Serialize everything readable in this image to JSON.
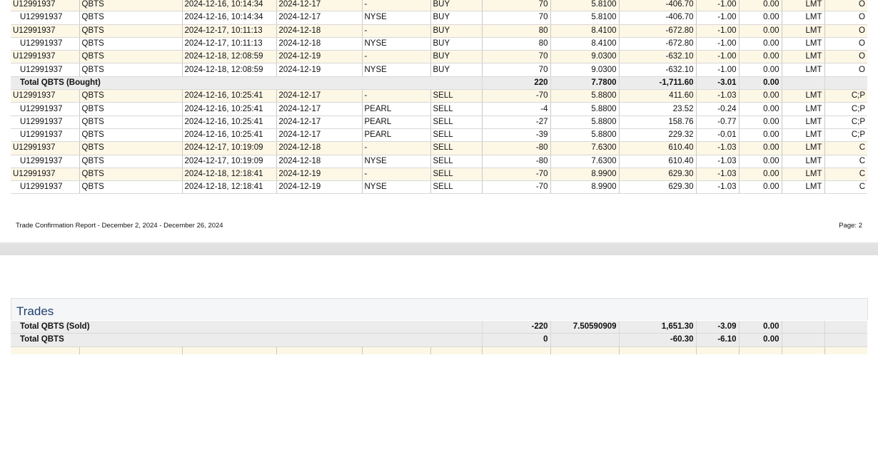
{
  "columns_align": [
    "l",
    "l",
    "l",
    "l",
    "l",
    "l",
    "r",
    "r",
    "r",
    "r",
    "r",
    "r",
    "r"
  ],
  "trades_top": [
    {
      "type": "main",
      "cells": [
        "U12991937",
        "QBTS",
        "2024-12-16, 10:14:34",
        "2024-12-17",
        "-",
        "BUY",
        "70",
        "5.8100",
        "-406.70",
        "-1.00",
        "0.00",
        "LMT",
        "O"
      ]
    },
    {
      "type": "sub",
      "cells": [
        "U12991937",
        "QBTS",
        "2024-12-16, 10:14:34",
        "2024-12-17",
        "NYSE",
        "BUY",
        "70",
        "5.8100",
        "-406.70",
        "-1.00",
        "0.00",
        "LMT",
        "O"
      ]
    },
    {
      "type": "main",
      "cells": [
        "U12991937",
        "QBTS",
        "2024-12-17, 10:11:13",
        "2024-12-18",
        "-",
        "BUY",
        "80",
        "8.4100",
        "-672.80",
        "-1.00",
        "0.00",
        "LMT",
        "O"
      ]
    },
    {
      "type": "sub",
      "cells": [
        "U12991937",
        "QBTS",
        "2024-12-17, 10:11:13",
        "2024-12-18",
        "NYSE",
        "BUY",
        "80",
        "8.4100",
        "-672.80",
        "-1.00",
        "0.00",
        "LMT",
        "O"
      ]
    },
    {
      "type": "main",
      "cells": [
        "U12991937",
        "QBTS",
        "2024-12-18, 12:08:59",
        "2024-12-19",
        "-",
        "BUY",
        "70",
        "9.0300",
        "-632.10",
        "-1.00",
        "0.00",
        "LMT",
        "O"
      ]
    },
    {
      "type": "sub",
      "cells": [
        "U12991937",
        "QBTS",
        "2024-12-18, 12:08:59",
        "2024-12-19",
        "NYSE",
        "BUY",
        "70",
        "9.0300",
        "-632.10",
        "-1.00",
        "0.00",
        "LMT",
        "O"
      ]
    },
    {
      "type": "tot",
      "label": "Total QBTS (Bought)",
      "cells": [
        "220",
        "7.7800",
        "-1,711.60",
        "-3.01",
        "0.00",
        "",
        ""
      ]
    },
    {
      "type": "main",
      "cells": [
        "U12991937",
        "QBTS",
        "2024-12-16, 10:25:41",
        "2024-12-17",
        "-",
        "SELL",
        "-70",
        "5.8800",
        "411.60",
        "-1.03",
        "0.00",
        "LMT",
        "C;P"
      ]
    },
    {
      "type": "sub",
      "cells": [
        "U12991937",
        "QBTS",
        "2024-12-16, 10:25:41",
        "2024-12-17",
        "PEARL",
        "SELL",
        "-4",
        "5.8800",
        "23.52",
        "-0.24",
        "0.00",
        "LMT",
        "C;P"
      ]
    },
    {
      "type": "sub",
      "cells": [
        "U12991937",
        "QBTS",
        "2024-12-16, 10:25:41",
        "2024-12-17",
        "PEARL",
        "SELL",
        "-27",
        "5.8800",
        "158.76",
        "-0.77",
        "0.00",
        "LMT",
        "C;P"
      ]
    },
    {
      "type": "sub",
      "cells": [
        "U12991937",
        "QBTS",
        "2024-12-16, 10:25:41",
        "2024-12-17",
        "PEARL",
        "SELL",
        "-39",
        "5.8800",
        "229.32",
        "-0.01",
        "0.00",
        "LMT",
        "C;P"
      ]
    },
    {
      "type": "main",
      "cells": [
        "U12991937",
        "QBTS",
        "2024-12-17, 10:19:09",
        "2024-12-18",
        "-",
        "SELL",
        "-80",
        "7.6300",
        "610.40",
        "-1.03",
        "0.00",
        "LMT",
        "C"
      ]
    },
    {
      "type": "sub",
      "cells": [
        "U12991937",
        "QBTS",
        "2024-12-17, 10:19:09",
        "2024-12-18",
        "NYSE",
        "SELL",
        "-80",
        "7.6300",
        "610.40",
        "-1.03",
        "0.00",
        "LMT",
        "C"
      ]
    },
    {
      "type": "main",
      "cells": [
        "U12991937",
        "QBTS",
        "2024-12-18, 12:18:41",
        "2024-12-19",
        "-",
        "SELL",
        "-70",
        "8.9900",
        "629.30",
        "-1.03",
        "0.00",
        "LMT",
        "C"
      ]
    },
    {
      "type": "sub",
      "cells": [
        "U12991937",
        "QBTS",
        "2024-12-18, 12:18:41",
        "2024-12-19",
        "NYSE",
        "SELL",
        "-70",
        "8.9900",
        "629.30",
        "-1.03",
        "0.00",
        "LMT",
        "C"
      ]
    }
  ],
  "footer": {
    "title": "Trade Confirmation Report - December 2, 2024 - December 26, 2024",
    "page": "Page: 2"
  },
  "section_title": "Trades",
  "trades_bottom": [
    {
      "type": "tot",
      "label": "Total QBTS (Sold)",
      "cells": [
        "-220",
        "7.50590909",
        "1,651.30",
        "-3.09",
        "0.00",
        "",
        ""
      ]
    },
    {
      "type": "tot",
      "label": "Total QBTS",
      "cells": [
        "0",
        "",
        "-60.30",
        "-6.10",
        "0.00",
        "",
        ""
      ]
    },
    {
      "type": "main",
      "cells": [
        "",
        "",
        "",
        "",
        "",
        "",
        "",
        "",
        "",
        "",
        "",
        "",
        ""
      ]
    }
  ],
  "colors": {
    "row_highlight": "#fdf7e6",
    "total_row": "#ececec",
    "section_title": "#1f3f6e"
  }
}
